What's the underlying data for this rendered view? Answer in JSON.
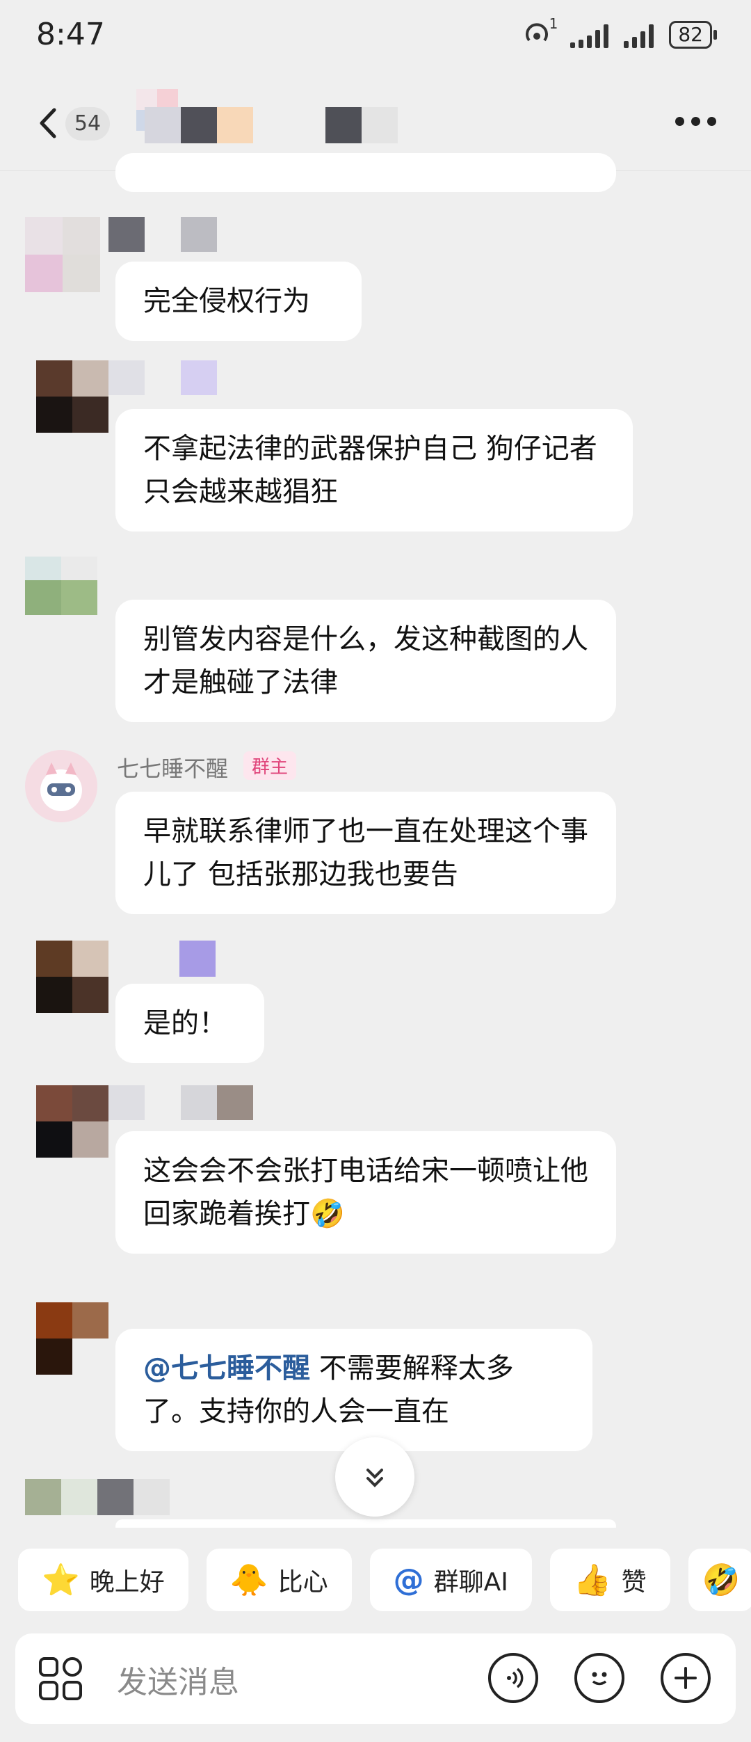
{
  "status_bar": {
    "time": "8:47",
    "hotspot_count": "1",
    "battery": "82"
  },
  "header": {
    "unread_count": "54"
  },
  "messages": [
    {
      "text": "完全侵权行为"
    },
    {
      "text": "不拿起法律的武器保护自己  狗仔记者只会越来越猖狂"
    },
    {
      "text": "别管发内容是什么，发这种截图的人才是触碰了法律"
    },
    {
      "sender": "七七睡不醒",
      "badge": "群主",
      "text": "早就联系律师了也一直在处理这个事儿了 包括张那边我也要告"
    },
    {
      "text": "是的！"
    },
    {
      "text": "这会会不会张打电话给宋一顿喷让他回家跪着挨打"
    },
    {
      "mention": "@七七睡不醒",
      "text": " 不需要解释太多了。支持你的人会一直在"
    }
  ],
  "quick_replies": [
    {
      "icon": "star-face-icon",
      "label": "晚上好"
    },
    {
      "icon": "heart-duck-icon",
      "label": "比心"
    },
    {
      "icon": "at-icon",
      "label": "群聊AI"
    },
    {
      "icon": "thumbs-up-icon",
      "label": "赞"
    }
  ],
  "input": {
    "placeholder": "发送消息"
  }
}
